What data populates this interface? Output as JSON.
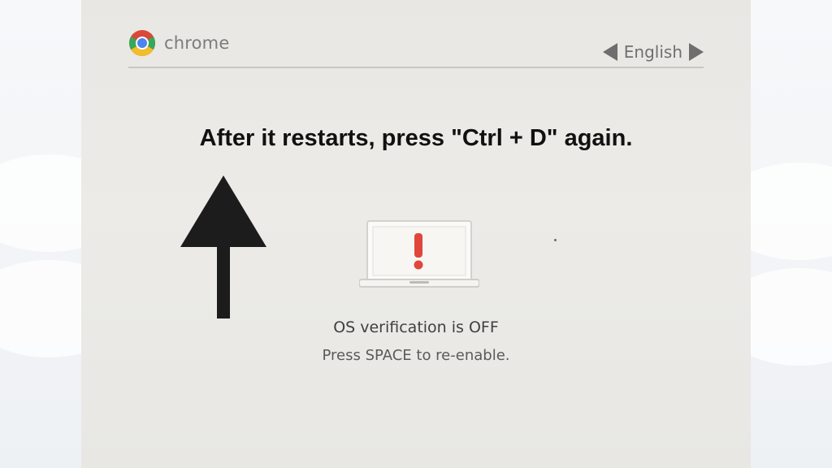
{
  "header": {
    "brand_name": "chrome",
    "logo_icon": "chrome-logo-icon",
    "language": "English",
    "prev_icon": "triangle-left-icon",
    "next_icon": "triangle-right-icon"
  },
  "instruction": "After it restarts, press \"Ctrl + D\" again.",
  "annotation_icon": "up-arrow-icon",
  "warning": {
    "icon": "laptop-warning-icon",
    "title": "OS verification is OFF",
    "subtitle": "Press SPACE to re-enable."
  },
  "colors": {
    "screen_bg": "#eae8e4",
    "warning_red": "#e0463b",
    "text_dark": "#111111",
    "text_grey": "#5a5a5a"
  }
}
